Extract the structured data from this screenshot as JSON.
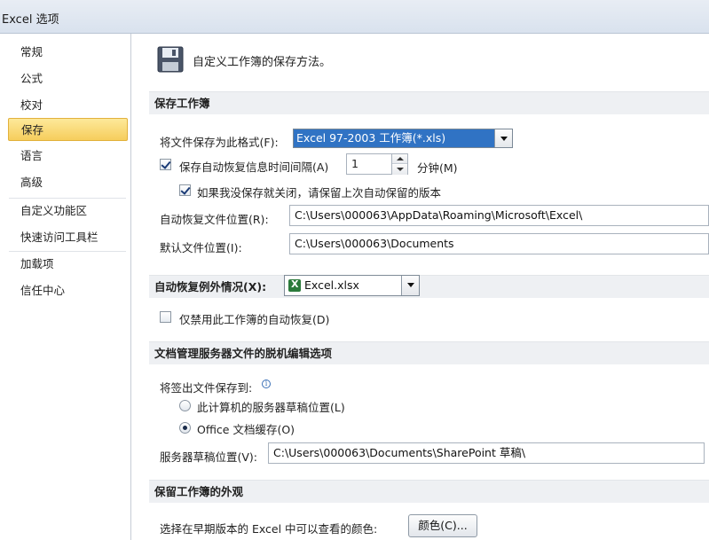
{
  "window": {
    "title": "Excel 选项"
  },
  "sidebar": {
    "items": [
      {
        "label": "常规",
        "selected": false
      },
      {
        "label": "公式",
        "selected": false
      },
      {
        "label": "校对",
        "selected": false
      },
      {
        "label": "保存",
        "selected": true
      },
      {
        "label": "语言",
        "selected": false
      },
      {
        "label": "高级",
        "selected": false
      },
      {
        "label": "自定义功能区",
        "selected": false
      },
      {
        "label": "快速访问工具栏",
        "selected": false
      },
      {
        "label": "加载项",
        "selected": false
      },
      {
        "label": "信任中心",
        "selected": false
      }
    ]
  },
  "main": {
    "header": {
      "icon": "save-disk-icon",
      "text": "自定义工作簿的保存方法。"
    },
    "save_section": {
      "title": "保存工作簿",
      "format_label": "将文件保存为此格式(F):",
      "format_value": "Excel 97-2003 工作簿(*.xls)",
      "autorecover_label": "保存自动恢复信息时间间隔(A)",
      "autorecover_checked": true,
      "autorecover_minutes": "1",
      "minutes_label": "分钟(M)",
      "keep_last_label": "如果我没保存就关闭，请保留上次自动保留的版本",
      "keep_last_checked": true,
      "autorecover_location_label": "自动恢复文件位置(R):",
      "autorecover_location_value": "C:\\Users\\000063\\AppData\\Roaming\\Microsoft\\Excel\\",
      "default_location_label": "默认文件位置(I):",
      "default_location_value": "C:\\Users\\000063\\Documents"
    },
    "autorecover_exceptions": {
      "title": "自动恢复例外情况(X):",
      "workbook_value": "Excel.xlsx",
      "disable_label": "仅禁用此工作簿的自动恢复(D)",
      "disable_checked": false
    },
    "offline_section": {
      "title": "文档管理服务器文件的脱机编辑选项",
      "save_checked_out_label": "将签出文件保存到:",
      "option_server_label": "此计算机的服务器草稿位置(L)",
      "option_cache_label": "Office 文档缓存(O)",
      "selected_option": "cache",
      "drafts_location_label": "服务器草稿位置(V):",
      "drafts_location_value": "C:\\Users\\000063\\Documents\\SharePoint 草稿\\"
    },
    "appearance_section": {
      "title": "保留工作簿的外观",
      "colors_label": "选择在早期版本的 Excel 中可以查看的颜色:",
      "colors_button": "颜色(C)..."
    }
  }
}
